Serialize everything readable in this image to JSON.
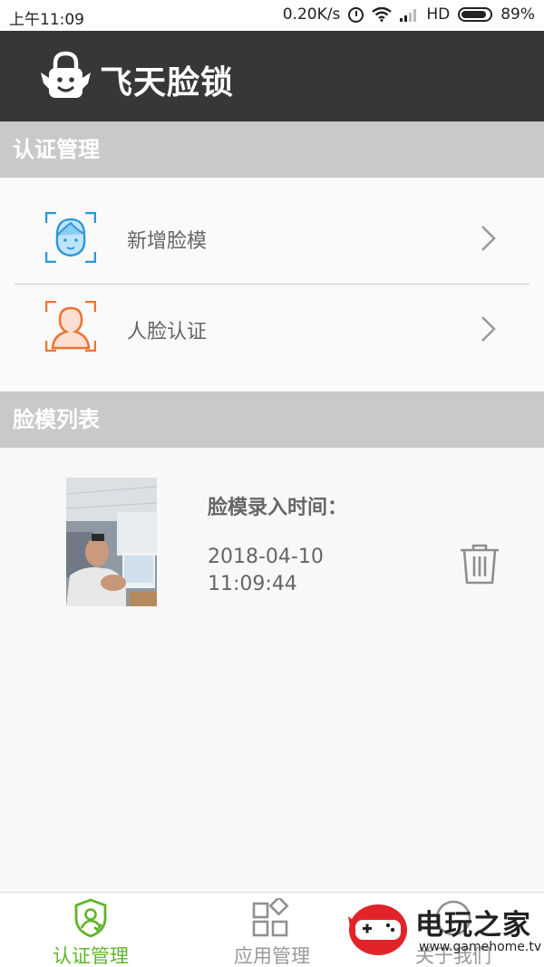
{
  "status_bar": {
    "time": "上午11:09",
    "speed": "0.20K/s",
    "network": "HD",
    "battery": "89%"
  },
  "header": {
    "title": "飞天脸锁"
  },
  "sections": {
    "auth": "认证管理",
    "faces": "脸模列表"
  },
  "menu": {
    "add_face": "新增脸模",
    "verify_face": "人脸认证"
  },
  "face_list": {
    "time_label": "脸模录入时间：",
    "date": "2018-04-10",
    "clock": "11:09:44"
  },
  "bottom_nav": {
    "tabs": [
      {
        "label": "认证管理",
        "icon": "shield-user-icon",
        "active": true
      },
      {
        "label": "应用管理",
        "icon": "grid-apps-icon",
        "active": false
      },
      {
        "label": "关于我们",
        "icon": "info-icon",
        "active": false
      }
    ]
  },
  "watermark": {
    "name": "电玩之家",
    "url": "www.gamehome.tv"
  },
  "colors": {
    "appbar": "#37373a",
    "section": "#c9c9c9",
    "active": "#5fb529",
    "blue_icon": "#2c97d6",
    "orange_icon": "#ee7232"
  }
}
